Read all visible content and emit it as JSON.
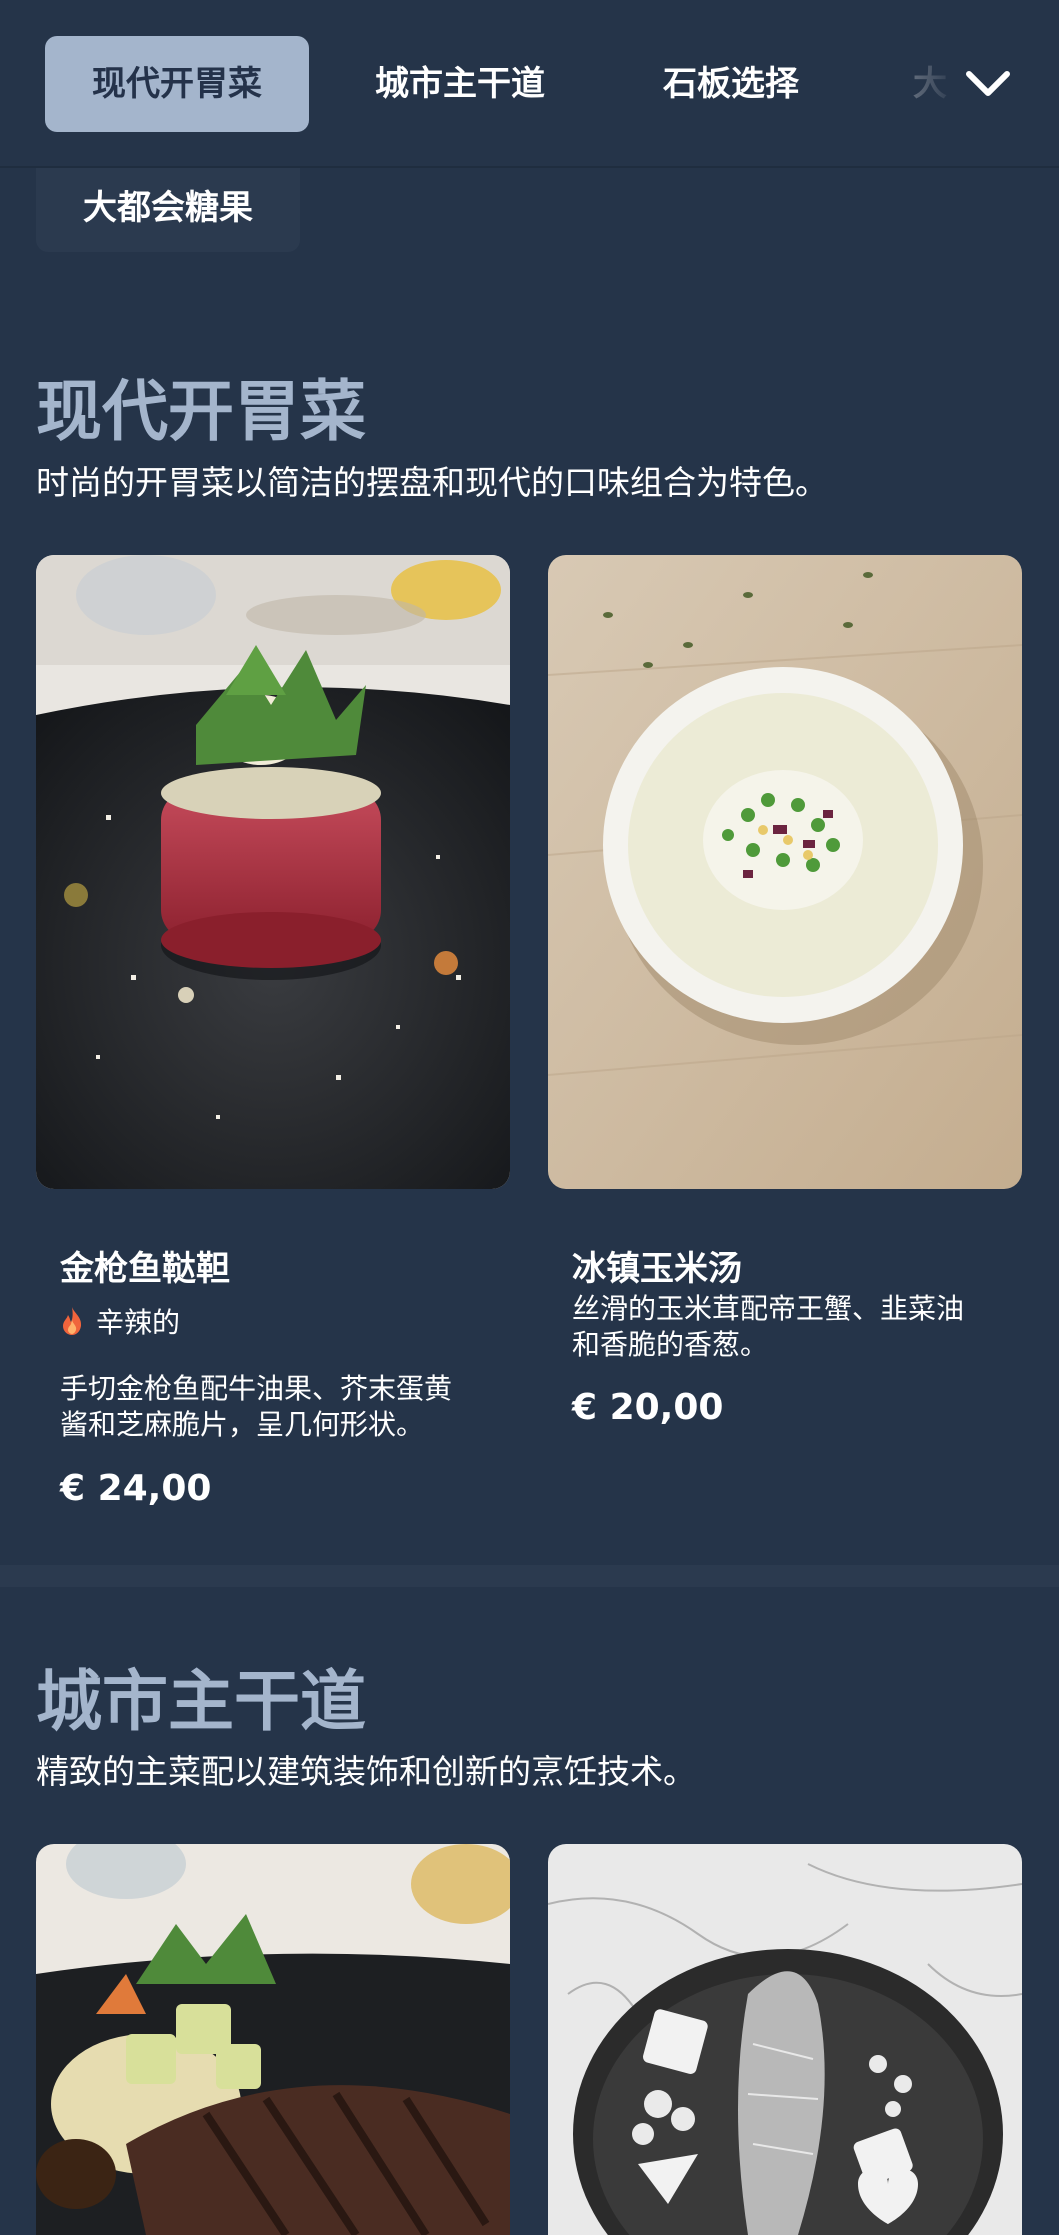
{
  "nav": {
    "tabs": [
      {
        "label": "现代开胃菜",
        "active": true
      },
      {
        "label": "城市主干道",
        "active": false
      },
      {
        "label": "石板选择",
        "active": false
      },
      {
        "label": "大",
        "active": false
      }
    ],
    "second_row": [
      {
        "label": "大都会糖果"
      }
    ],
    "expand_icon": "chevron-down-icon"
  },
  "sections": [
    {
      "title": "现代开胃菜",
      "description": "时尚的开胃菜以简洁的摆盘和现代的口味组合为特色。",
      "items": [
        {
          "name": "金枪鱼鞑靼",
          "tag": {
            "icon": "flame-icon",
            "label": "辛辣的"
          },
          "description_lines": [
            "手切金枪鱼配牛油果、芥末蛋黄",
            "酱和芝麻脆片，呈几何形状。"
          ],
          "price": "€ 24,00"
        },
        {
          "name": "冰镇玉米汤",
          "description_lines": [
            "丝滑的玉米茸配帝王蟹、韭菜油",
            "和香脆的香葱。"
          ],
          "price": "€ 20,00"
        }
      ]
    },
    {
      "title": "城市主干道",
      "description": "精致的主菜配以建筑装饰和创新的烹饪技术。"
    }
  ],
  "colors": {
    "background": "#253449",
    "accent": "#a4b5cc",
    "flame": "#f0643c"
  }
}
